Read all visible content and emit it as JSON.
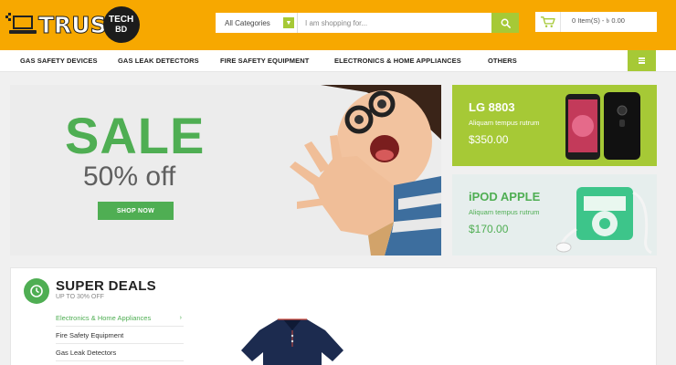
{
  "brand": {
    "name": "TRUS",
    "badge_line1": "TECH",
    "badge_line2": "BD"
  },
  "search": {
    "category_selected": "All Categories",
    "placeholder": "I am shopping for..."
  },
  "cart": {
    "summary": "0 Item(S) - ৳ 0.00"
  },
  "nav": {
    "items": [
      {
        "label": "GAS SAFETY DEVICES"
      },
      {
        "label": "GAS LEAK DETECTORS"
      },
      {
        "label": "FIRE SAFETY EQUIPMENT"
      },
      {
        "label": "ELECTRONICS & HOME APPLIANCES"
      },
      {
        "label": "OTHERS"
      }
    ]
  },
  "hero": {
    "headline": "SALE",
    "subline": "50% off",
    "button_label": "SHOP NOW"
  },
  "promos": [
    {
      "title": "LG 8803",
      "subtitle": "Aliquam tempus rutrum",
      "price": "$350.00"
    },
    {
      "title": "iPOD APPLE",
      "subtitle": "Aliquam tempus rutrum",
      "price": "$170.00"
    }
  ],
  "deals": {
    "title": "SUPER DEALS",
    "subtitle": "UP TO 30% OFF",
    "categories": [
      {
        "label": "Electronics & Home Appliances"
      },
      {
        "label": "Fire Safety Equipment"
      },
      {
        "label": "Gas Leak Detectors"
      }
    ]
  },
  "colors": {
    "header_orange": "#f7a800",
    "accent_green": "#a6c936",
    "brand_green": "#4fae53"
  },
  "icons": [
    "search-icon",
    "cart-icon",
    "menu-icon",
    "clock-icon",
    "chevron-right-icon",
    "chevron-down-icon"
  ]
}
